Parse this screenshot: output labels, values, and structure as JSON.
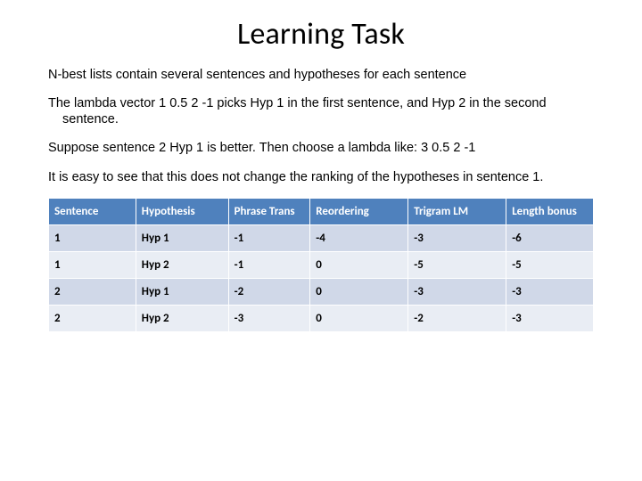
{
  "title": "Learning Task",
  "paragraphs": {
    "p1": "N-best lists contain several sentences and hypotheses for each sentence",
    "p2": "The lambda vector 1 0.5 2 -1 picks Hyp 1 in the first sentence, and Hyp 2 in the second sentence.",
    "p3": "Suppose sentence 2 Hyp 1 is better. Then choose a lambda like: 3 0.5 2 -1",
    "p4": "It is easy to see that this does not change the ranking of the hypotheses in sentence 1."
  },
  "table": {
    "headers": [
      "Sentence",
      "Hypothesis",
      "Phrase Trans",
      "Reordering",
      "Trigram LM",
      "Length bonus"
    ],
    "rows": [
      [
        "1",
        "Hyp 1",
        "-1",
        "-4",
        "-3",
        "-6"
      ],
      [
        "1",
        "Hyp 2",
        "-1",
        " 0",
        "-5",
        "-5"
      ],
      [
        "2",
        "Hyp 1",
        "-2",
        "0",
        "-3",
        "-3"
      ],
      [
        "2",
        "Hyp 2",
        "-3",
        "0",
        "-2",
        "-3"
      ]
    ]
  }
}
